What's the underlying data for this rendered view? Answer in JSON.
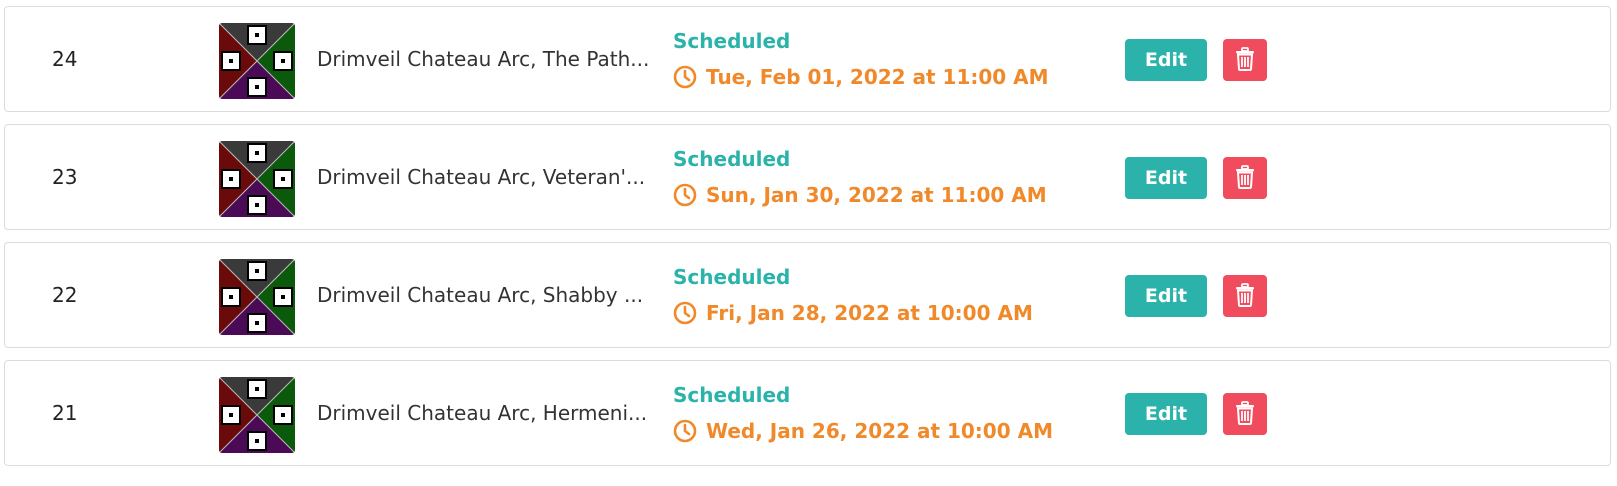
{
  "colors": {
    "status_teal": "#2bb3ab",
    "date_orange": "#f0892a",
    "delete_red": "#f14b5e",
    "edit_teal": "#2bb3ab"
  },
  "icons": {
    "time": "clock-icon",
    "delete": "trash-icon",
    "thumbnail": "arc-thumbnail-icon"
  },
  "rows": [
    {
      "number": "24",
      "title": "Drimveil Chateau Arc, The Path...",
      "status": "Scheduled",
      "datetime": "Tue, Feb 01, 2022 at 11:00 AM",
      "edit_label": "Edit"
    },
    {
      "number": "23",
      "title": "Drimveil Chateau Arc, Veteran'...",
      "status": "Scheduled",
      "datetime": "Sun, Jan 30, 2022 at 11:00 AM",
      "edit_label": "Edit"
    },
    {
      "number": "22",
      "title": "Drimveil Chateau Arc, Shabby ...",
      "status": "Scheduled",
      "datetime": "Fri, Jan 28, 2022 at 10:00 AM",
      "edit_label": "Edit"
    },
    {
      "number": "21",
      "title": "Drimveil Chateau Arc, Hermeni...",
      "status": "Scheduled",
      "datetime": "Wed, Jan 26, 2022 at 10:00 AM",
      "edit_label": "Edit"
    }
  ]
}
